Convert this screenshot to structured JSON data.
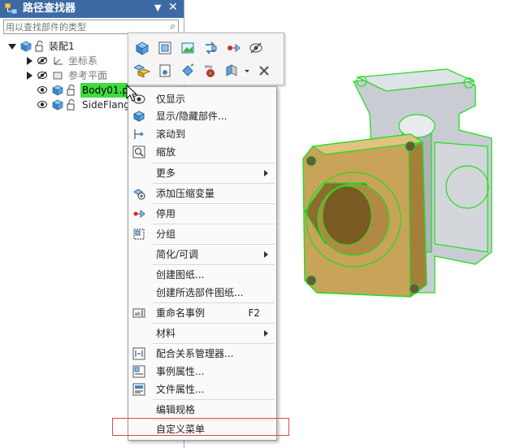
{
  "panel": {
    "title": "路径查找器",
    "search_placeholder": "用以查找部件的类型",
    "tree": [
      {
        "label": "装配1",
        "level": 0,
        "state": "expanded"
      },
      {
        "label": "坐标系",
        "level": 1,
        "state": "collapsed",
        "style": "gray"
      },
      {
        "label": "参考平面",
        "level": 1,
        "state": "collapsed",
        "style": "gray"
      },
      {
        "label": "Body01.p",
        "level": 1,
        "state": "leaf",
        "style": "selected"
      },
      {
        "label": "SideFlang",
        "level": 1,
        "state": "leaf",
        "style": "normal"
      }
    ]
  },
  "toolbar": {
    "buttons": [
      "show-only-icon",
      "fit-view-icon",
      "image-icon",
      "swap-icon",
      "suppress-icon",
      "hide-icon",
      "multi-body-icon",
      "save-icon",
      "paint-icon",
      "mv-icon",
      "section-icon",
      "dropdown-icon",
      "close-icon"
    ]
  },
  "menu": {
    "items": [
      {
        "label": "仅显示",
        "icon": "show-only-icon"
      },
      {
        "label": "显示/隐藏部件...",
        "icon": "show-hide-icon"
      },
      {
        "label": "滚动到",
        "icon": "scroll-to-icon"
      },
      {
        "label": "缩放",
        "icon": "zoom-icon"
      },
      {
        "label": "更多",
        "submenu": true
      },
      {
        "label": "添加压缩变量",
        "icon": "add-variable-icon"
      },
      {
        "label": "停用",
        "icon": "deactivate-icon"
      },
      {
        "label": "分组",
        "icon": "group-icon"
      },
      {
        "label": "简化/可调",
        "submenu": true
      },
      {
        "label": "创建图纸..."
      },
      {
        "label": "创建所选部件图纸..."
      },
      {
        "label": "重命名事例",
        "shortcut": "F2",
        "icon": "rename-icon"
      },
      {
        "label": "材料",
        "submenu": true
      },
      {
        "label": "配合关系管理器...",
        "icon": "relation-manager-icon"
      },
      {
        "label": "事例属性...",
        "icon": "occurrence-props-icon"
      },
      {
        "label": "文件属性...",
        "icon": "file-props-icon"
      },
      {
        "label": "编辑规格"
      },
      {
        "label": "自定义菜单",
        "highlighted": true
      }
    ]
  },
  "colors": {
    "title_bar": "#3d6aa5",
    "selection": "#3ddc3d",
    "highlight_box": "#e0474c",
    "model_gold": "#c9a35a",
    "model_edges": "#22dd22"
  }
}
